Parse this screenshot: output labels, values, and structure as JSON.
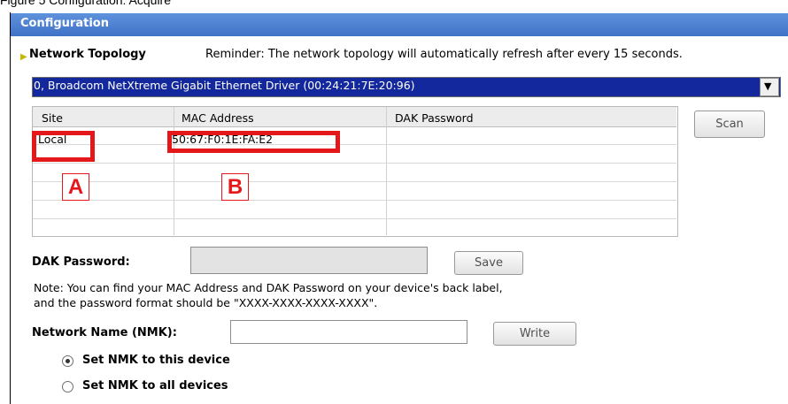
{
  "figure_caption": "Figure 5 Configuration: Acquire",
  "window": {
    "title": "Configuration"
  },
  "network_topology": {
    "title": "Network Topology",
    "reminder": "Reminder: The network topology will automatically refresh after every 15 seconds.",
    "adapter_selected": "0, Broadcom NetXtreme Gigabit Ethernet Driver (00:24:21:7E:20:96)",
    "columns": [
      "Site",
      "MAC Address",
      "DAK Password"
    ],
    "rows": [
      {
        "site": "Local",
        "mac": "50:67:F0:1E:FA:E2",
        "dak": ""
      }
    ],
    "scan_label": "Scan"
  },
  "callouts": {
    "a": "A",
    "b": "B"
  },
  "dak": {
    "label": "DAK Password:",
    "value": "",
    "save_label": "Save",
    "note_line1": "Note: You can find your MAC Address and DAK Password on your device's back label,",
    "note_line2": "and the password format should be \"XXXX-XXXX-XXXX-XXXX\"."
  },
  "nmk": {
    "label": "Network Name (NMK):",
    "value": "",
    "write_label": "Write",
    "options": [
      {
        "label": "Set NMK to this device",
        "selected": true
      },
      {
        "label": "Set NMK to all devices",
        "selected": false
      }
    ]
  },
  "colors": {
    "header_blue": "#3f72c6",
    "adapter_blue": "#12289c",
    "callout_red": "#e4171a"
  }
}
